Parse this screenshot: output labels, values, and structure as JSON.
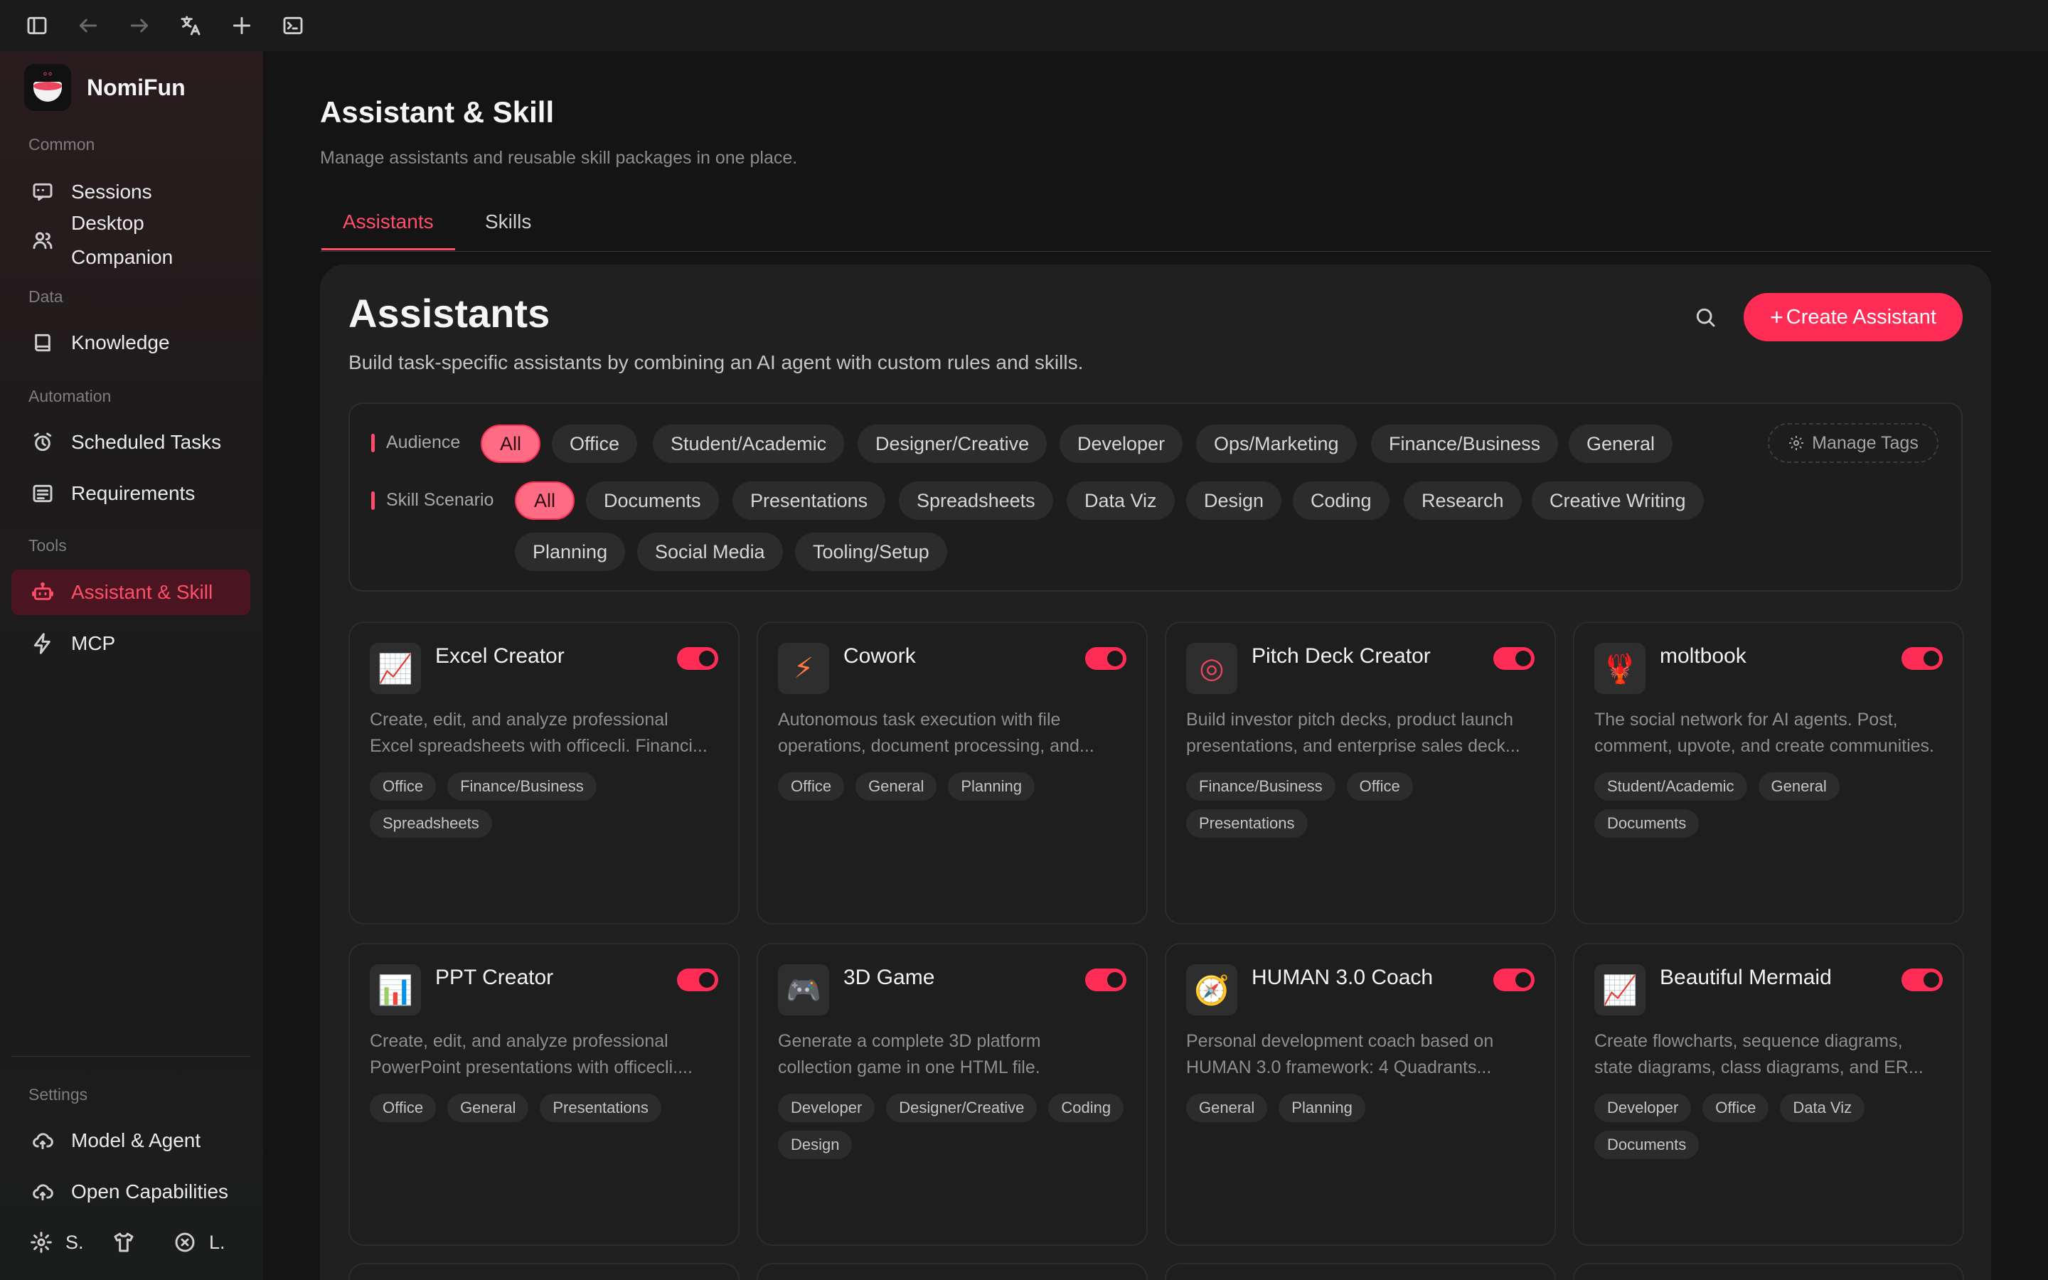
{
  "sidebar": {
    "brand": "NomiFun",
    "sections": {
      "common": "Common",
      "data": "Data",
      "automation": "Automation",
      "tools": "Tools",
      "settings": "Settings"
    },
    "items": {
      "sessions": "Sessions",
      "desktop_line1": "Desktop",
      "desktop_line2": "Companion",
      "knowledge": "Knowledge",
      "scheduled_tasks": "Scheduled Tasks",
      "requirements": "Requirements",
      "assistant_skill": "Assistant & Skill",
      "mcp": "MCP",
      "model_agent": "Model & Agent",
      "open_capabilities": "Open Capabilities"
    },
    "footer": {
      "settings_short": "S.",
      "language_short": "L."
    }
  },
  "header": {
    "title": "Assistant & Skill",
    "subtitle": "Manage assistants and reusable skill packages in one place.",
    "tabs": [
      "Assistants",
      "Skills"
    ]
  },
  "panel": {
    "title": "Assistants",
    "subtitle": "Build task-specific assistants by combining an AI agent with custom rules and skills.",
    "create_label": "Create Assistant",
    "manage_tags": "Manage Tags"
  },
  "filters": {
    "audience_label": "Audience",
    "audience": [
      "All",
      "Office",
      "Student/Academic",
      "Designer/Creative",
      "Developer",
      "Ops/Marketing",
      "Finance/Business",
      "General"
    ],
    "scenario_label": "Skill Scenario",
    "scenario": [
      "All",
      "Documents",
      "Presentations",
      "Spreadsheets",
      "Data Viz",
      "Design",
      "Coding",
      "Research",
      "Creative Writing",
      "Planning",
      "Social Media",
      "Tooling/Setup"
    ]
  },
  "cards": [
    {
      "name": "Excel Creator",
      "icon": "chart-up-icon",
      "desc_1": "Create, edit, and analyze professional",
      "desc_2": "Excel spreadsheets with officecli. Financi...",
      "tags": [
        "Office",
        "Finance/Business",
        "Spreadsheets"
      ],
      "enabled": true
    },
    {
      "name": "Cowork",
      "icon": "lightning-icon",
      "desc_1": "Autonomous task execution with file",
      "desc_2": "operations, document processing, and...",
      "tags": [
        "Office",
        "General",
        "Planning"
      ],
      "enabled": true
    },
    {
      "name": "Pitch Deck Creator",
      "icon": "target-icon",
      "desc_1": "Build investor pitch decks, product launch",
      "desc_2": "presentations, and enterprise sales deck...",
      "tags": [
        "Finance/Business",
        "Office",
        "Presentations"
      ],
      "enabled": true
    },
    {
      "name": "moltbook",
      "icon": "lobster-icon",
      "desc_1": "The social network for AI agents. Post,",
      "desc_2": "comment, upvote, and create communities.",
      "tags": [
        "Student/Academic",
        "General",
        "Documents"
      ],
      "enabled": true
    },
    {
      "name": "PPT Creator",
      "icon": "bar-chart-icon",
      "desc_1": "Create, edit, and analyze professional",
      "desc_2": "PowerPoint presentations with officecli....",
      "tags": [
        "Office",
        "General",
        "Presentations"
      ],
      "enabled": true
    },
    {
      "name": "3D Game",
      "icon": "gamepad-icon",
      "desc_1": "Generate a complete 3D platform",
      "desc_2": "collection game in one HTML file.",
      "tags": [
        "Developer",
        "Designer/Creative",
        "Coding",
        "Design"
      ],
      "enabled": true
    },
    {
      "name": "HUMAN 3.0 Coach",
      "icon": "compass-icon",
      "desc_1": "Personal development coach based on",
      "desc_2": "HUMAN 3.0 framework: 4 Quadrants...",
      "tags": [
        "General",
        "Planning"
      ],
      "enabled": true
    },
    {
      "name": "Beautiful Mermaid",
      "icon": "chart-up-icon",
      "desc_1": "Create flowcharts, sequence diagrams,",
      "desc_2": "state diagrams, class diagrams, and ER...",
      "tags": [
        "Developer",
        "Office",
        "Data Viz",
        "Documents"
      ],
      "enabled": true
    }
  ],
  "colors": {
    "accent": "#ff2d55",
    "active_nav_bg": "#4a1520"
  }
}
